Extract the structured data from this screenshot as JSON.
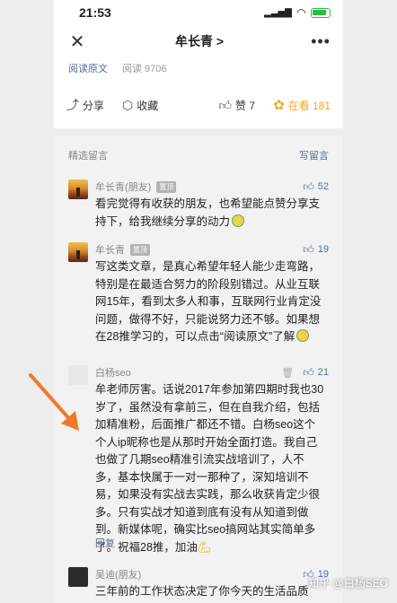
{
  "status_bar": {
    "time": "21:53"
  },
  "navbar": {
    "title": "牟长青 >"
  },
  "article": {
    "read_original": "阅读原文",
    "read_count": "阅读 9706"
  },
  "actions": {
    "share": "分享",
    "favorite": "收藏",
    "like": "赞 7",
    "zaikan": "在看 181"
  },
  "comments_section": {
    "title": "精选留言",
    "write": "写留言"
  },
  "comments": [
    {
      "author": "牟长青(朋友)",
      "tag": "置顶",
      "likes": "52",
      "text": "看完觉得有收获的朋友，也希望能点赞分享支持下，给我继续分享的动力"
    },
    {
      "author": "牟长青",
      "tag": "置顶",
      "likes": "19",
      "text": "写这类文章，是真心希望年轻人能少走弯路，特别是在最适合努力的阶段别错过。从业互联网15年，看到太多人和事，互联网行业肯定没问题，做得不好，只能说努力还不够。如果想在28推学习的，可以点击“阅读原文”了解"
    },
    {
      "author": "白杨seo",
      "likes": "21",
      "text": "牟老师厉害。话说2017年参加第四期时我也30岁了，虽然没有拿前三，但在自我介绍，包括加精准粉，后面推广都还不错。白杨seo这个个人ip昵称也是从那时开始全面打造。我自己也做了几期seo精准引流实战培训了，人不多，基本快属于一对一那种了，深知培训不易，如果没有实战去实践，那么收获肯定少很多。只有实战才知道到底有没有从知道到做到。新媒体呢，确实比seo搞网站其实简单多了。祝福28推，加油",
      "reply": "回复"
    },
    {
      "author": "吴迪(朋友)",
      "likes": "19",
      "text": "三年前的工作状态决定了你今天的生活品质"
    }
  ],
  "watermark": "知乎 @白杨SEO"
}
